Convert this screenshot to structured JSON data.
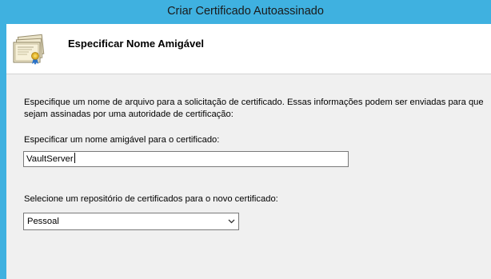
{
  "window": {
    "title": "Criar Certificado Autoassinado"
  },
  "header": {
    "title": "Especificar Nome Amigável",
    "icon": "certificate-icon"
  },
  "body": {
    "description": "Especifique um nome de arquivo para a solicitação de certificado. Essas informações podem ser enviadas para que sejam assinadas por uma autoridade de certificação:",
    "friendly_name_label": "Especificar um nome amigável para o certificado:",
    "friendly_name_value": "VaultServer",
    "store_label": "Selecione um repositório de certificados para o novo certificado:",
    "store_selected": "Pessoal"
  },
  "colors": {
    "titlebar": "#3fb1e0",
    "header_bg": "#ffffff",
    "content_bg": "#f0f0f0"
  }
}
